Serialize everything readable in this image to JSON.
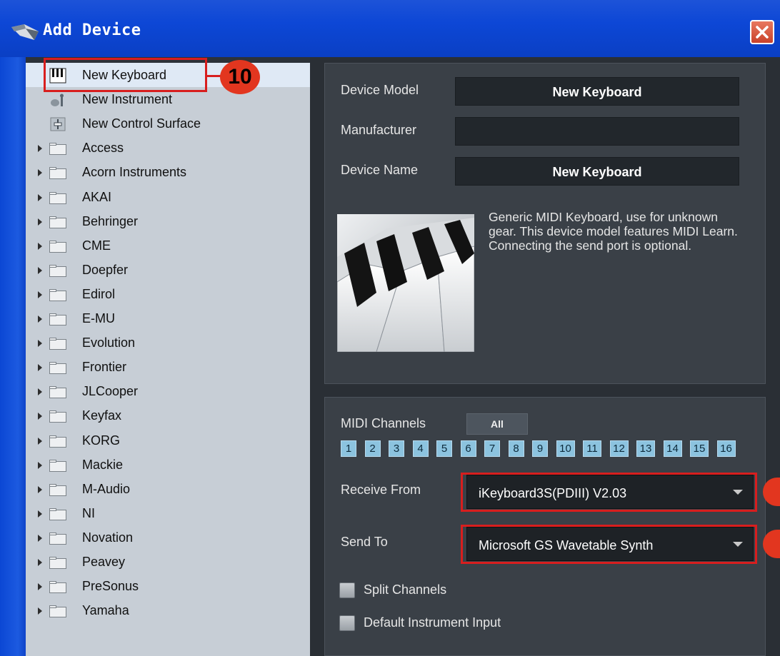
{
  "window": {
    "title": "Add Device"
  },
  "device_list": {
    "items": [
      {
        "label": "New Keyboard",
        "kind": "keyboard-icon",
        "selected": true
      },
      {
        "label": "New Instrument",
        "kind": "instrument-icon"
      },
      {
        "label": "New Control Surface",
        "kind": "control-surface-icon"
      },
      {
        "label": "Access",
        "kind": "folder"
      },
      {
        "label": "Acorn Instruments",
        "kind": "folder"
      },
      {
        "label": "AKAI",
        "kind": "folder"
      },
      {
        "label": "Behringer",
        "kind": "folder"
      },
      {
        "label": "CME",
        "kind": "folder"
      },
      {
        "label": "Doepfer",
        "kind": "folder"
      },
      {
        "label": "Edirol",
        "kind": "folder"
      },
      {
        "label": "E-MU",
        "kind": "folder"
      },
      {
        "label": "Evolution",
        "kind": "folder"
      },
      {
        "label": "Frontier",
        "kind": "folder"
      },
      {
        "label": "JLCooper",
        "kind": "folder"
      },
      {
        "label": "Keyfax",
        "kind": "folder"
      },
      {
        "label": "KORG",
        "kind": "folder"
      },
      {
        "label": "Mackie",
        "kind": "folder"
      },
      {
        "label": "M-Audio",
        "kind": "folder"
      },
      {
        "label": "NI",
        "kind": "folder"
      },
      {
        "label": "Novation",
        "kind": "folder"
      },
      {
        "label": "Peavey",
        "kind": "folder"
      },
      {
        "label": "PreSonus",
        "kind": "folder"
      },
      {
        "label": "Yamaha",
        "kind": "folder"
      }
    ]
  },
  "callout": {
    "number": "10"
  },
  "device_info": {
    "model_label": "Device Model",
    "model_value": "New Keyboard",
    "manufacturer_label": "Manufacturer",
    "manufacturer_value": "",
    "name_label": "Device Name",
    "name_value": "New Keyboard",
    "description": "Generic MIDI Keyboard, use for unknown gear. This device model features MIDI Learn. Connecting the send port is optional."
  },
  "midi": {
    "channels_label": "MIDI Channels",
    "all_label": "All",
    "channels": [
      "1",
      "2",
      "3",
      "4",
      "5",
      "6",
      "7",
      "8",
      "9",
      "10",
      "11",
      "12",
      "13",
      "14",
      "15",
      "16"
    ],
    "receive_label": "Receive From",
    "receive_value": "iKeyboard3S(PDIII) V2.03",
    "send_label": "Send To",
    "send_value": "Microsoft GS Wavetable Synth",
    "split_label": "Split Channels",
    "default_input_label": "Default Instrument Input"
  },
  "colors": {
    "titlebar": "#0d47d6",
    "accent_red": "#d81e1e",
    "channel_blue": "#8cc3df"
  }
}
